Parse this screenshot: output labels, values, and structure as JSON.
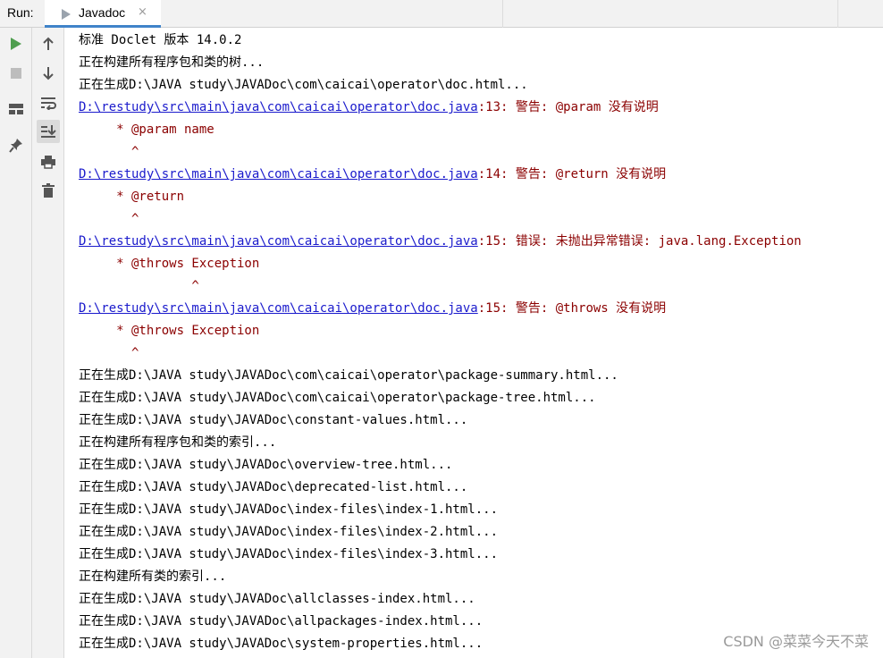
{
  "run_panel": {
    "run_label": "Run:",
    "tab_label": "Javadoc",
    "close_glyph": "×"
  },
  "toolbar": {
    "tools_left": [
      {
        "icon": "play-icon",
        "color": "#4f9e4f"
      },
      {
        "icon": "stop-icon",
        "color": "#bdbdbd"
      },
      {
        "icon": "layout-icon",
        "color": "#555555"
      },
      {
        "icon": "pin-icon",
        "color": "#555555"
      }
    ],
    "tools_right": [
      {
        "icon": "arrow-up-icon"
      },
      {
        "icon": "arrow-down-icon"
      },
      {
        "icon": "soft-wrap-icon"
      },
      {
        "icon": "scroll-to-end-icon",
        "selected": true
      },
      {
        "icon": "print-icon"
      },
      {
        "icon": "trash-icon"
      }
    ]
  },
  "colors": {
    "error_text": "#8b0000",
    "link_text": "#1a1acc",
    "tab_accent": "#4083c9"
  },
  "console": {
    "lines": [
      {
        "text": "标准 Doclet 版本 14.0.2"
      },
      {
        "text": "正在构建所有程序包和类的树..."
      },
      {
        "text": "正在生成D:\\JAVA study\\JAVADoc\\com\\caicai\\operator\\doc.html..."
      },
      {
        "link": "D:\\restudy\\src\\main\\java\\com\\caicai\\operator\\doc.java",
        "text": ":13: 警告: @param 没有说明",
        "error": true
      },
      {
        "text": "     * @param name",
        "error": true
      },
      {
        "text": "       ^",
        "error": true
      },
      {
        "link": "D:\\restudy\\src\\main\\java\\com\\caicai\\operator\\doc.java",
        "text": ":14: 警告: @return 没有说明",
        "error": true
      },
      {
        "text": "     * @return",
        "error": true
      },
      {
        "text": "       ^",
        "error": true
      },
      {
        "link": "D:\\restudy\\src\\main\\java\\com\\caicai\\operator\\doc.java",
        "text": ":15: 错误: 未抛出异常错误: java.lang.Exception",
        "error": true
      },
      {
        "text": "     * @throws Exception",
        "error": true
      },
      {
        "text": "               ^",
        "error": true
      },
      {
        "link": "D:\\restudy\\src\\main\\java\\com\\caicai\\operator\\doc.java",
        "text": ":15: 警告: @throws 没有说明",
        "error": true
      },
      {
        "text": "     * @throws Exception",
        "error": true
      },
      {
        "text": "       ^",
        "error": true
      },
      {
        "text": "正在生成D:\\JAVA study\\JAVADoc\\com\\caicai\\operator\\package-summary.html..."
      },
      {
        "text": "正在生成D:\\JAVA study\\JAVADoc\\com\\caicai\\operator\\package-tree.html..."
      },
      {
        "text": "正在生成D:\\JAVA study\\JAVADoc\\constant-values.html..."
      },
      {
        "text": "正在构建所有程序包和类的索引..."
      },
      {
        "text": "正在生成D:\\JAVA study\\JAVADoc\\overview-tree.html..."
      },
      {
        "text": "正在生成D:\\JAVA study\\JAVADoc\\deprecated-list.html..."
      },
      {
        "text": "正在生成D:\\JAVA study\\JAVADoc\\index-files\\index-1.html..."
      },
      {
        "text": "正在生成D:\\JAVA study\\JAVADoc\\index-files\\index-2.html..."
      },
      {
        "text": "正在生成D:\\JAVA study\\JAVADoc\\index-files\\index-3.html..."
      },
      {
        "text": "正在构建所有类的索引..."
      },
      {
        "text": "正在生成D:\\JAVA study\\JAVADoc\\allclasses-index.html..."
      },
      {
        "text": "正在生成D:\\JAVA study\\JAVADoc\\allpackages-index.html..."
      },
      {
        "text": "正在生成D:\\JAVA study\\JAVADoc\\system-properties.html..."
      }
    ]
  },
  "watermark": "CSDN @菜菜今天不菜"
}
